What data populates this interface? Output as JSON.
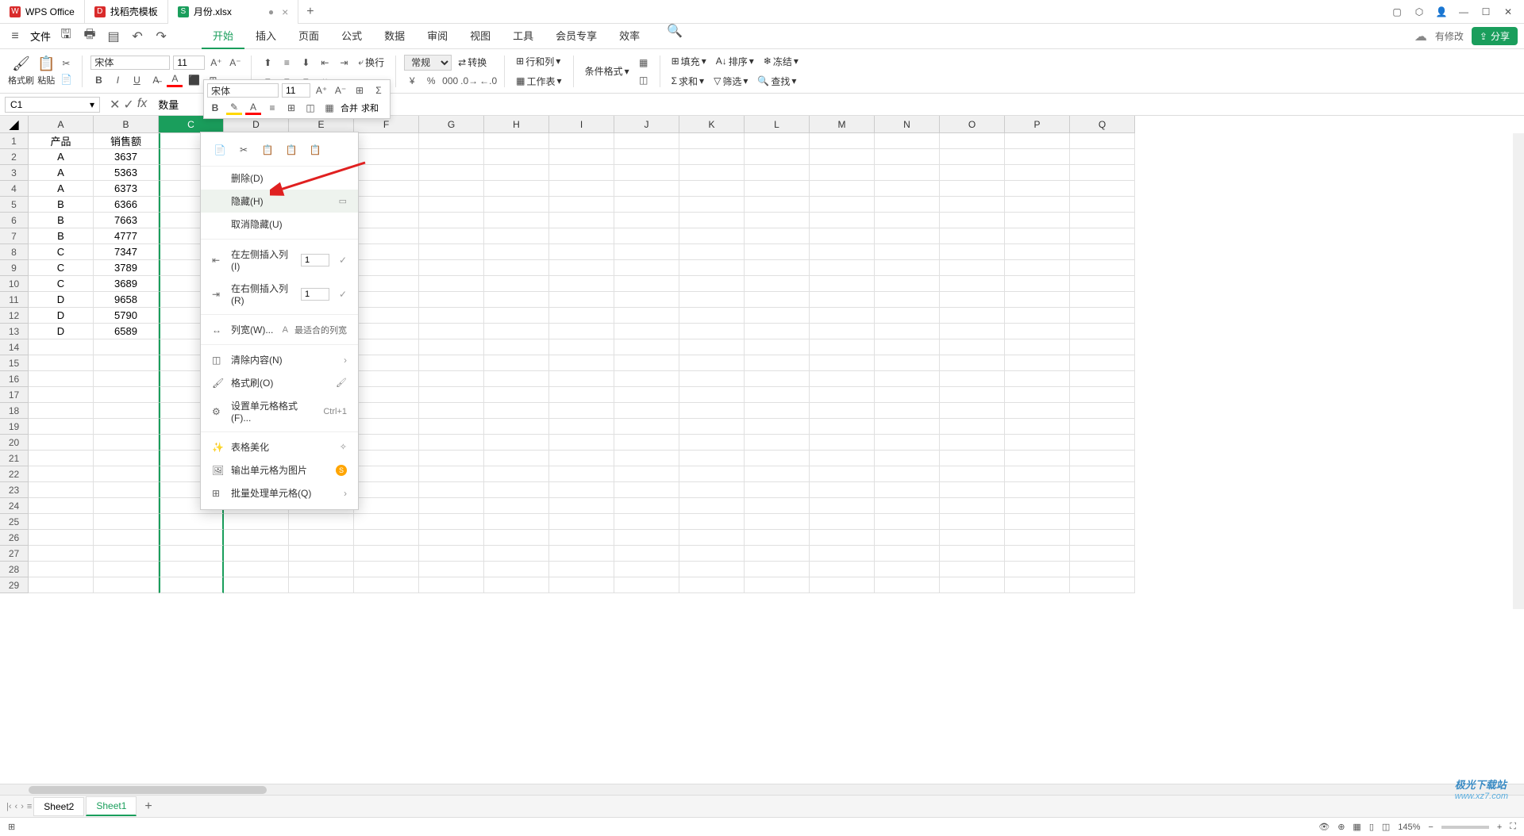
{
  "titlebar": {
    "tabs": [
      {
        "icon": "W",
        "label": "WPS Office"
      },
      {
        "icon": "D",
        "label": "找稻壳模板"
      },
      {
        "icon": "S",
        "label": "月份.xlsx",
        "dirty": "●"
      }
    ],
    "add": "+"
  },
  "menubar": {
    "file": "文件",
    "tabs": [
      "开始",
      "插入",
      "页面",
      "公式",
      "数据",
      "审阅",
      "视图",
      "工具",
      "会员专享",
      "效率"
    ],
    "has_changes": "有修改",
    "share": "分享"
  },
  "ribbon": {
    "format_brush": "格式刷",
    "paste": "粘贴",
    "font_name": "宋体",
    "font_size": "11",
    "wrap": "换行",
    "number_format": "常规",
    "convert": "转换",
    "rows_cols": "行和列",
    "worksheet": "工作表",
    "cond_format": "条件格式",
    "fill": "填充",
    "sort": "排序",
    "freeze": "冻结",
    "sum": "求和",
    "filter": "筛选",
    "find": "查找"
  },
  "mini_toolbar": {
    "font_name": "宋体",
    "font_size": "11",
    "merge": "合并",
    "sum": "求和"
  },
  "formula_bar": {
    "cell_ref": "C1",
    "value": "数量"
  },
  "columns": [
    "A",
    "B",
    "C",
    "D",
    "E",
    "F",
    "G",
    "H",
    "I",
    "J",
    "K",
    "L",
    "M",
    "N",
    "O",
    "P",
    "Q"
  ],
  "rows": [
    "1",
    "2",
    "3",
    "4",
    "5",
    "6",
    "7",
    "8",
    "9",
    "10",
    "11",
    "12",
    "13",
    "14",
    "15",
    "16",
    "17",
    "18",
    "19",
    "20",
    "21",
    "22",
    "23",
    "24",
    "25",
    "26",
    "27",
    "28",
    "29"
  ],
  "cells": {
    "headers": [
      "产品",
      "销售额"
    ],
    "data": [
      [
        "A",
        "3637"
      ],
      [
        "A",
        "5363"
      ],
      [
        "A",
        "6373"
      ],
      [
        "B",
        "6366"
      ],
      [
        "B",
        "7663"
      ],
      [
        "B",
        "4777"
      ],
      [
        "C",
        "7347"
      ],
      [
        "C",
        "3789"
      ],
      [
        "C",
        "3689"
      ],
      [
        "D",
        "9658"
      ],
      [
        "D",
        "5790"
      ],
      [
        "D",
        "6589"
      ]
    ]
  },
  "context_menu": {
    "delete": "删除(D)",
    "hide": "隐藏(H)",
    "unhide": "取消隐藏(U)",
    "insert_left": "在左侧插入列(I)",
    "insert_right": "在右侧插入列(R)",
    "insert_count": "1",
    "col_width": "列宽(W)...",
    "best_width": "最适合的列宽",
    "clear": "清除内容(N)",
    "format_brush": "格式刷(O)",
    "cell_format": "设置单元格格式(F)...",
    "cell_format_sc": "Ctrl+1",
    "beautify": "表格美化",
    "export_img": "输出单元格为图片",
    "batch": "批量处理单元格(Q)"
  },
  "sheets": {
    "sheet2": "Sheet2",
    "sheet1": "Sheet1"
  },
  "status": {
    "zoom": "145%"
  },
  "watermark": {
    "brand": "极光下载站",
    "url": "www.xz7.com"
  }
}
